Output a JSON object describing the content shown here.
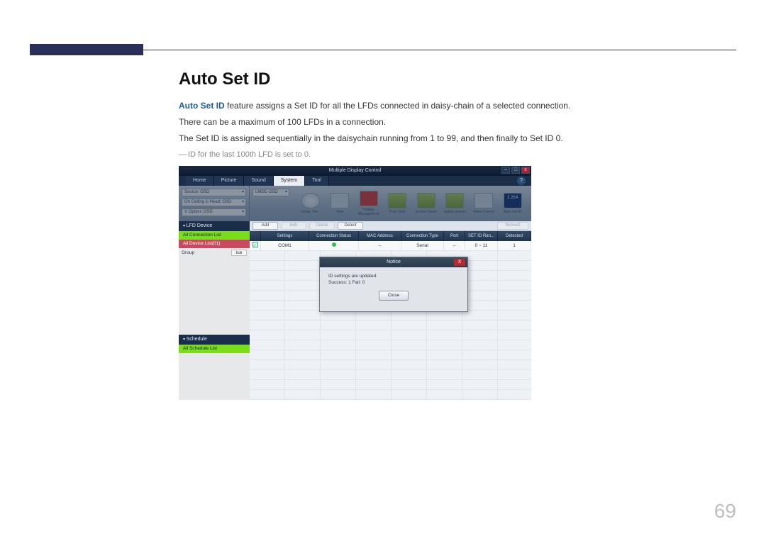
{
  "page": {
    "heading": "Auto Set ID",
    "lead_strong": "Auto Set ID",
    "lead_rest": " feature assigns a Set ID for all the LFDs connected in daisy-chain of a selected connection.",
    "p2": "There can be a maximum of 100 LFDs in a connection.",
    "p3": "The Set ID is assigned sequentially in the daisychain running from 1 to 99, and then finally to Set ID 0.",
    "note": "ID for the last 100th LFD is set to 0.",
    "number": "69"
  },
  "app": {
    "title": "Multiple Display Control",
    "win": {
      "min": "–",
      "max": "□",
      "close": "x"
    },
    "tabs": [
      "Home",
      "Picture",
      "Sound",
      "System",
      "Tool"
    ],
    "active_tab": "System",
    "help": "?",
    "ribbon_left": [
      "Source: OSD",
      "On Ceiling is Head: OSD",
      "V Option: OSD"
    ],
    "ribbon_left_combo": "LMDE-OSD",
    "tools": [
      "Clock, Tim...",
      "Tone",
      "Holiday Management",
      "Pixel Shift",
      "Screen Saver",
      "Safety Screen",
      "Video Control",
      "Auto Set ID"
    ],
    "sidebar": {
      "lfd_device": "LFD Device",
      "all_connection_list": "All Connection List",
      "all_device_list": "All Device List(01)",
      "group": "Group",
      "edit": "Edit",
      "schedule": "Schedule",
      "all_schedule_list": "All Schedule List"
    },
    "toolbar": {
      "add": "Add",
      "edit": "Edit",
      "delete": "Delete",
      "detect": "Detect",
      "refresh": "Refresh"
    },
    "columns": [
      "",
      "Settings",
      "Connection Status",
      "MAC Address",
      "Connection Type",
      "Port",
      "SET ID Ran...",
      "Detected Devices"
    ],
    "row": {
      "settings": "COM1",
      "mac": "--",
      "type": "Serial",
      "port": "--",
      "range": "0 ~ 11",
      "detected": "1"
    },
    "dialog": {
      "title": "Notice",
      "line1": "ID settings are updated.",
      "line2": "Success: 1  Fail: 0",
      "close_btn": "Close",
      "x": "X"
    }
  }
}
